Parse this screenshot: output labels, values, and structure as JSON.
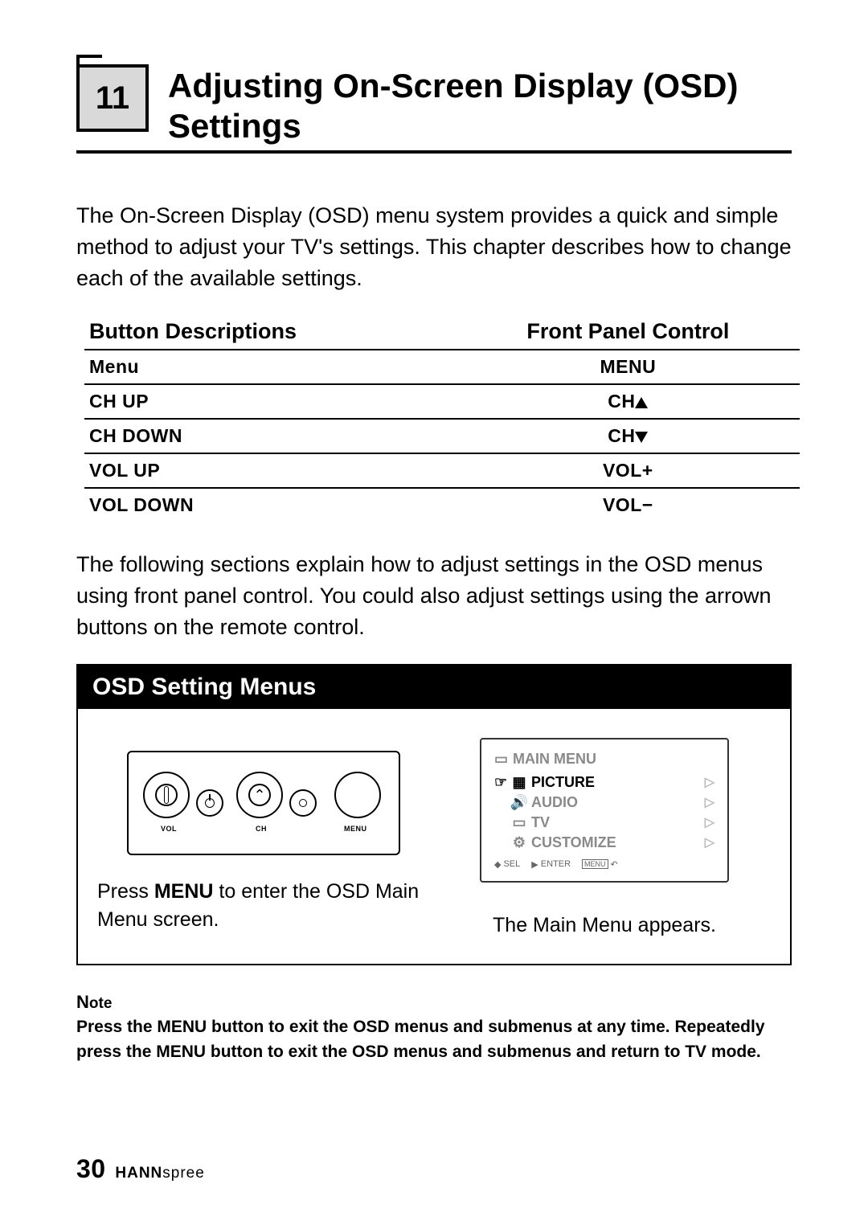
{
  "chapter": {
    "number": "11",
    "title": "Adjusting On-Screen Display (OSD) Settings"
  },
  "intro": "The On-Screen Display (OSD) menu system provides a quick and simple method to adjust your TV's settings. This chapter describes how to change each of the available settings.",
  "button_table": {
    "head_descriptions": "Button Descriptions",
    "head_control": "Front Panel Control",
    "rows": [
      {
        "desc": "Menu",
        "ctrl": "MENU",
        "icon": "none"
      },
      {
        "desc": "CH UP",
        "ctrl": "CH",
        "icon": "up"
      },
      {
        "desc": "CH DOWN",
        "ctrl": "CH",
        "icon": "down"
      },
      {
        "desc": "VOL UP",
        "ctrl": "VOL+",
        "icon": "none"
      },
      {
        "desc": "VOL DOWN",
        "ctrl": "VOL−",
        "icon": "none"
      }
    ]
  },
  "mid_para": "The following sections explain how to adjust settings in the OSD menus using front panel control. You could also adjust settings using the arrown buttons on the remote control.",
  "osd_panel": {
    "header": "OSD Setting Menus",
    "left_caption_a": "Press ",
    "left_caption_strong": "MENU",
    "left_caption_b": " to enter the OSD Main Menu screen.",
    "right_caption": "The Main Menu appears.",
    "panel_labels": {
      "vol": "VOL",
      "ch": "CH",
      "menu": "MENU"
    },
    "screen": {
      "title": "MAIN  MENU",
      "items": [
        {
          "label": "PICTURE",
          "selected": true
        },
        {
          "label": "AUDIO",
          "selected": false
        },
        {
          "label": "TV",
          "selected": false
        },
        {
          "label": "CUSTOMIZE",
          "selected": false
        }
      ],
      "footer_sel": "SEL",
      "footer_enter": "ENTER",
      "footer_menu": "MENU"
    }
  },
  "note": {
    "label": "Note",
    "text": "Press the MENU button to exit the OSD menus and submenus at any time. Repeatedly press the MENU button to exit the OSD menus and submenus and return to TV mode."
  },
  "footer": {
    "page": "30",
    "brand_bold": "HANN",
    "brand_light": "spree"
  }
}
